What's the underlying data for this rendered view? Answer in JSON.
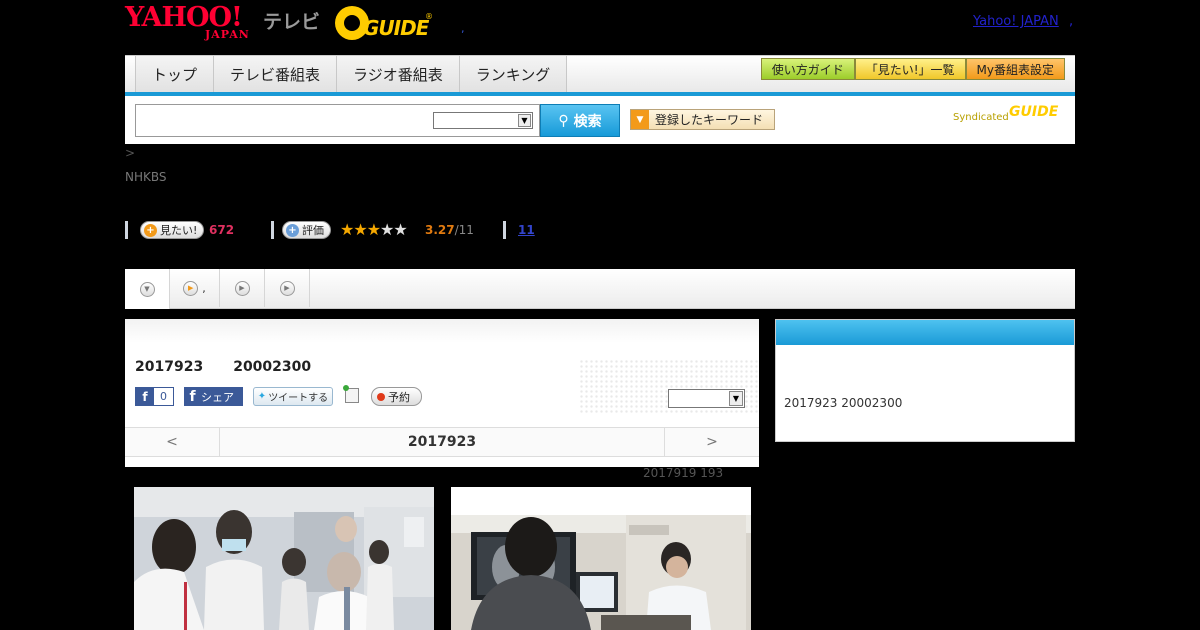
{
  "header": {
    "logo_yahoo": "YAHOO!",
    "logo_japan": "JAPAN",
    "logo_tv": "テレビ",
    "logo_gguide": "GUIDE",
    "yahoo_japan_link": "Yahoo! JAPAN"
  },
  "nav": {
    "tabs": [
      "トップ",
      "テレビ番組表",
      "ラジオ番組表",
      "ランキング"
    ],
    "buttons": [
      "使い方ガイド",
      "「見たい!」一覧",
      "My番組表設定"
    ]
  },
  "search": {
    "value": "",
    "button_label": "検索",
    "keyword_button_label": "登録したキーワード",
    "syndicated_label": "Syndicated",
    "syndicated_logo": "GUIDE"
  },
  "breadcrumb": ">",
  "channel": "NHKBS",
  "stats": {
    "mitai_label": "見たい!",
    "mitai_count": "672",
    "hyoka_label": "評価",
    "rating": 3.27,
    "rating_text": "3.27",
    "rating_count": "/11",
    "review_link": "11"
  },
  "program": {
    "air_date": "2017923",
    "air_time": "20002300",
    "fb_count": "0",
    "fb_share_label": "シェア",
    "tweet_label": "ツイートする",
    "reserve_label": "予約",
    "nav_prev": "<",
    "nav_next": ">",
    "nav_date": "2017923",
    "updated": "2017919  193"
  },
  "side": {
    "text": "2017923  20002300"
  },
  "colors": {
    "brand_red": "#ff0033",
    "accent_blue": "#1a9ad6",
    "gguide_yellow": "#ffcc00",
    "star_on": "#f5a800",
    "count_red": "#e03060"
  },
  "icons": {
    "search": "search-icon",
    "facebook": "facebook-icon",
    "twitter": "twitter-icon",
    "calendar": "calendar-add-icon",
    "record": "record-dot-icon"
  }
}
